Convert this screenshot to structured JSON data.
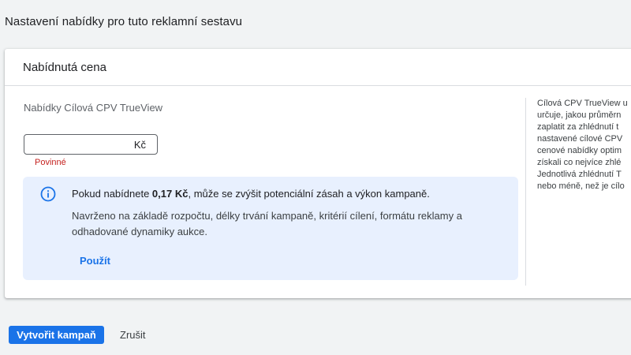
{
  "page": {
    "title": "Nastavení nabídky pro tuto reklamní sestavu"
  },
  "card": {
    "header": "Nabídnutá cena",
    "field_label": "Nabídky Cílová CPV TrueView",
    "input_value": "",
    "currency": "Kč",
    "required_text": "Povinné"
  },
  "info": {
    "line1_prefix": "Pokud nabídnete ",
    "line1_bold": "0,17 Kč",
    "line1_suffix": ", může se zvýšit potenciální zásah a výkon kampaně.",
    "line2": "Navrženo na základě rozpočtu, délky trvání kampaně, kritérií cílení, formátu reklamy a odhadované dynamiky aukce.",
    "apply_label": "Použít"
  },
  "side_help": {
    "lines": [
      "Cílová CPV TrueView u",
      "určuje, jakou průměrn",
      "zaplatit za zhlédnutí t",
      "nastavené cílové CPV",
      "cenové nabídky optim",
      "získali co nejvíce zhlé",
      "Jednotlivá zhlédnutí T",
      "nebo méně, než je cílo"
    ]
  },
  "actions": {
    "create_label": "Vytvořit kampaň",
    "cancel_label": "Zrušit"
  },
  "colors": {
    "accent": "#1a73e8",
    "error": "#c5221f",
    "info_bg": "#e8f0fe"
  }
}
